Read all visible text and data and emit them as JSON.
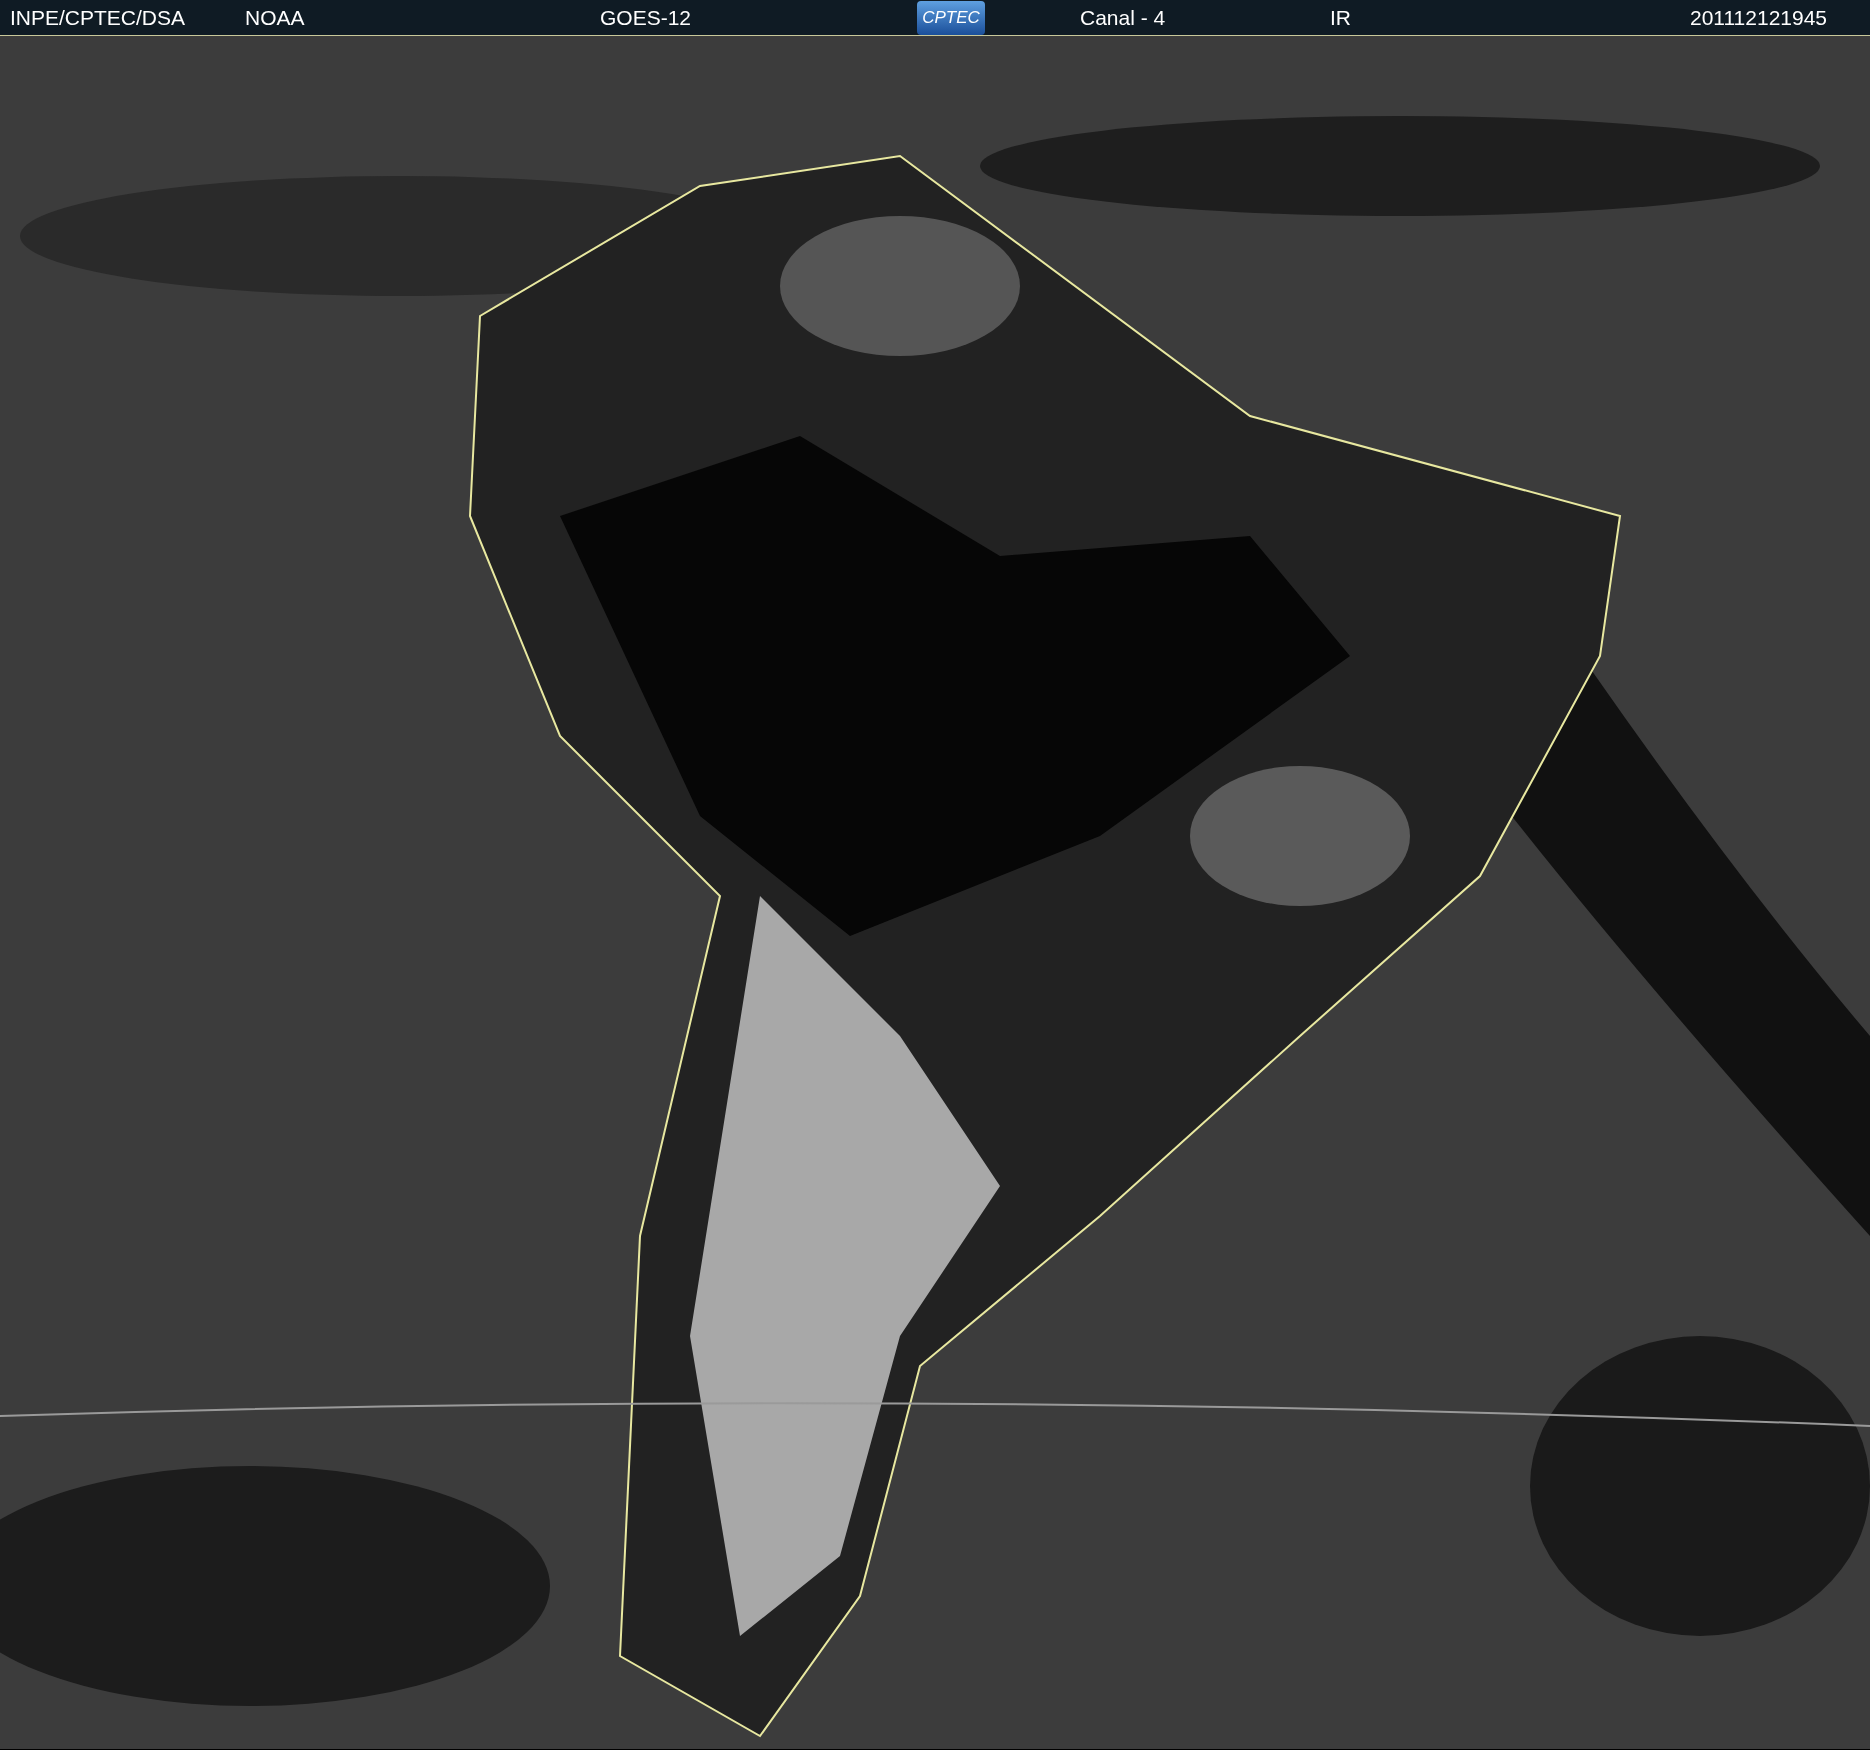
{
  "header": {
    "agency": "INPE/CPTEC/DSA",
    "source": "NOAA",
    "satellite": "GOES-12",
    "logo_text": "CPTEC",
    "channel": "Canal - 4",
    "band": "IR",
    "timestamp": "201112121945"
  }
}
